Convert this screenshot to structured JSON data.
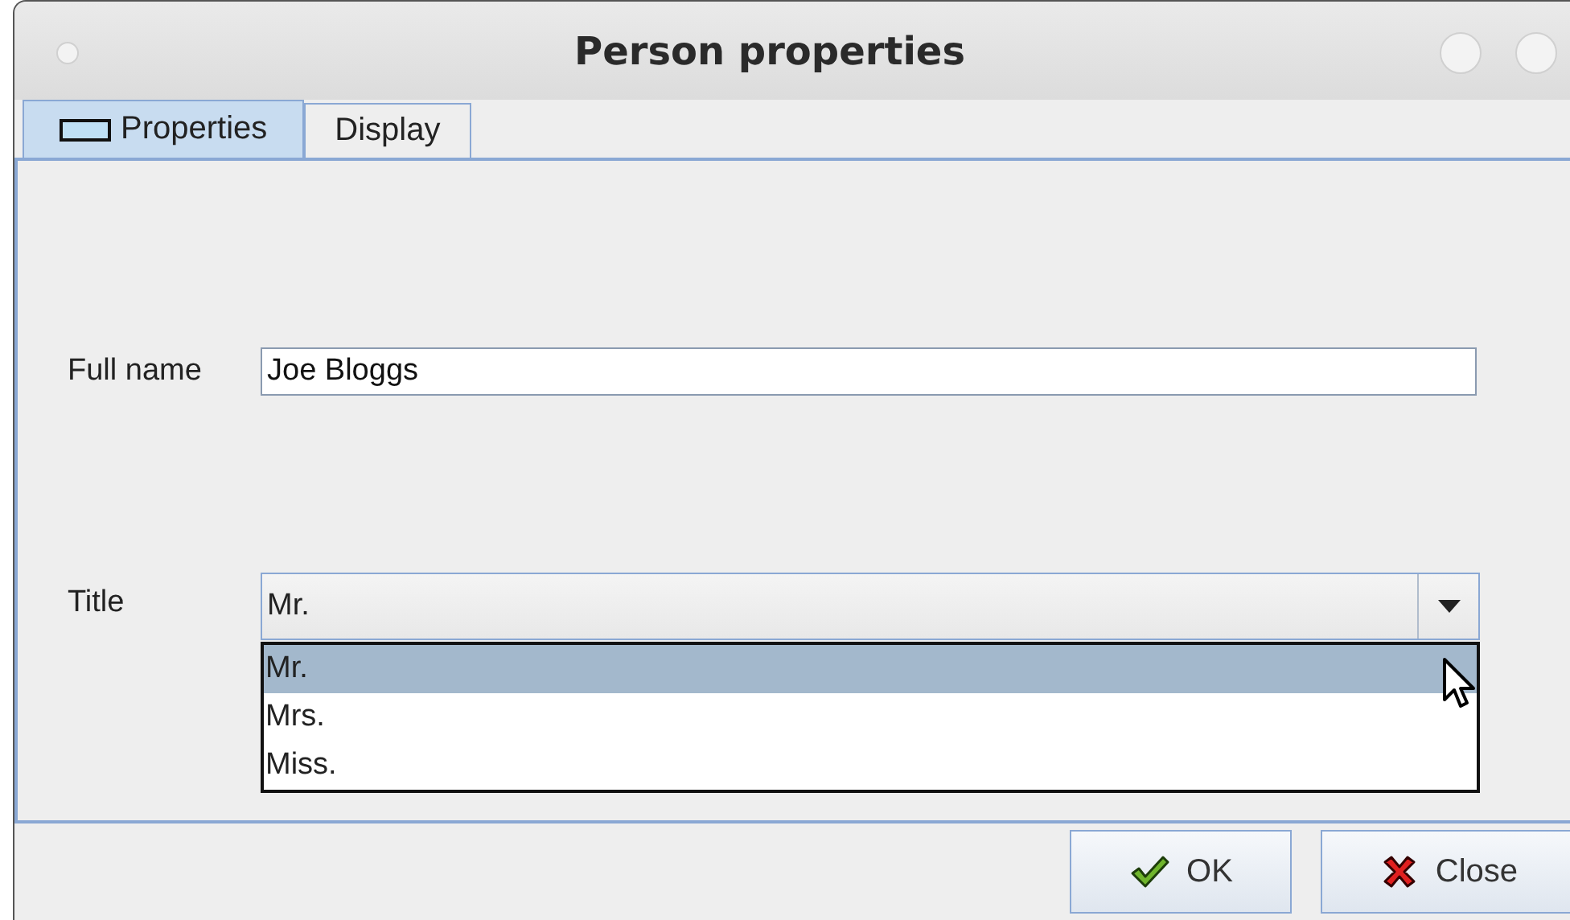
{
  "window": {
    "title": "Person properties"
  },
  "tabs": [
    {
      "label": "Properties",
      "selected": true,
      "kind": "icon"
    },
    {
      "label": "Display",
      "selected": false,
      "kind": "plain"
    }
  ],
  "full_name": {
    "label": "Full name",
    "value": "Joe Bloggs"
  },
  "title_field": {
    "label": "Title",
    "value": "Mr.",
    "expanded": true,
    "options": [
      {
        "label": "Mr.",
        "selected": true
      },
      {
        "label": "Mrs.",
        "selected": false
      },
      {
        "label": "Miss.",
        "selected": false
      }
    ]
  },
  "buttons": [
    {
      "label": "OK",
      "kind": "ok"
    },
    {
      "label": "Close",
      "kind": "close"
    }
  ]
}
